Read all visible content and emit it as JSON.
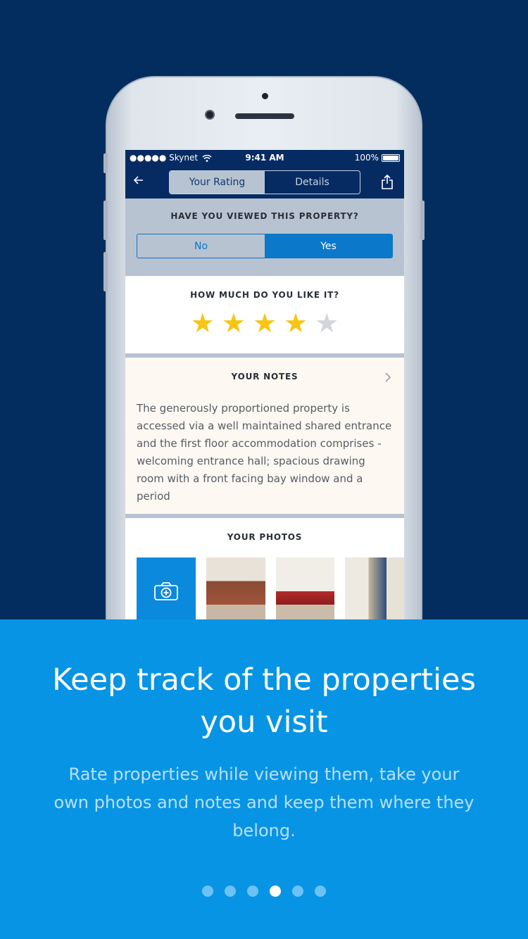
{
  "status": {
    "carrier": "●●●●● Skynet",
    "time": "9:41 AM",
    "battery": "100%"
  },
  "nav": {
    "tabs": [
      "Your Rating",
      "Details"
    ]
  },
  "viewed": {
    "title": "HAVE YOU VIEWED THIS PROPERTY?",
    "no": "No",
    "yes": "Yes",
    "selected": "Yes"
  },
  "rating": {
    "title": "HOW MUCH DO YOU LIKE IT?",
    "value": 4,
    "max": 5
  },
  "notes": {
    "title": "YOUR NOTES",
    "text": "The generously proportioned property is accessed via a well maintained shared entrance and the first floor accommodation comprises - welcoming entrance hall; spacious drawing room with a front facing bay window and a period"
  },
  "photos": {
    "title": "YOUR PHOTOS"
  },
  "panel": {
    "headline": "Keep track of the properties you visit",
    "subtext": "Rate properties while viewing them, take your own photos and notes and keep them where they belong."
  },
  "pager": {
    "count": 6,
    "active_index": 3
  },
  "colors": {
    "background": "#022d5e",
    "accent": "#0894e4",
    "star": "#f8c512"
  },
  "icons": [
    "back-arrow-icon",
    "share-icon",
    "chevron-right-icon",
    "camera-plus-icon",
    "wifi-icon",
    "battery-icon"
  ]
}
